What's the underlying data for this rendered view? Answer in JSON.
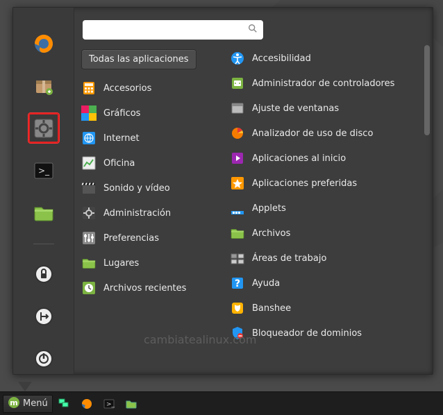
{
  "search": {
    "value": ""
  },
  "all_apps_label": "Todas las aplicaciones",
  "categories": [
    {
      "id": "accesorios",
      "label": "Accesorios",
      "icon": "calculator"
    },
    {
      "id": "graficos",
      "label": "Gráficos",
      "icon": "palette"
    },
    {
      "id": "internet",
      "label": "Internet",
      "icon": "globe"
    },
    {
      "id": "oficina",
      "label": "Oficina",
      "icon": "chart"
    },
    {
      "id": "sonido",
      "label": "Sonido y vídeo",
      "icon": "clapper"
    },
    {
      "id": "administracion",
      "label": "Administración",
      "icon": "gear-dark"
    },
    {
      "id": "preferencias",
      "label": "Preferencias",
      "icon": "sliders"
    },
    {
      "id": "lugares",
      "label": "Lugares",
      "icon": "folder"
    },
    {
      "id": "recientes",
      "label": "Archivos recientes",
      "icon": "clock-green"
    }
  ],
  "apps": [
    {
      "id": "accesibilidad",
      "label": "Accesibilidad",
      "icon": "accessibility"
    },
    {
      "id": "admin-controladores",
      "label": "Administrador de controladores",
      "icon": "driver"
    },
    {
      "id": "ajuste-ventanas",
      "label": "Ajuste de ventanas",
      "icon": "window"
    },
    {
      "id": "analizador-disco",
      "label": "Analizador de uso de disco",
      "icon": "disk-usage"
    },
    {
      "id": "apps-inicio",
      "label": "Aplicaciones al inicio",
      "icon": "startup"
    },
    {
      "id": "apps-preferidas",
      "label": "Aplicaciones preferidas",
      "icon": "star"
    },
    {
      "id": "applets",
      "label": "Applets",
      "icon": "applets"
    },
    {
      "id": "archivos",
      "label": "Archivos",
      "icon": "folder"
    },
    {
      "id": "areas-trabajo",
      "label": "Áreas de trabajo",
      "icon": "workspaces"
    },
    {
      "id": "ayuda",
      "label": "Ayuda",
      "icon": "help"
    },
    {
      "id": "banshee",
      "label": "Banshee",
      "icon": "banshee"
    },
    {
      "id": "bloqueador-dominios",
      "label": "Bloqueador de dominios",
      "icon": "shield"
    }
  ],
  "favorites": [
    {
      "id": "firefox",
      "icon": "firefox",
      "selected": false
    },
    {
      "id": "software",
      "icon": "package",
      "selected": false
    },
    {
      "id": "settings",
      "icon": "gear",
      "selected": true
    },
    {
      "id": "terminal",
      "icon": "terminal",
      "selected": false
    },
    {
      "id": "files",
      "icon": "folder",
      "selected": false
    }
  ],
  "favorites_session": [
    {
      "id": "lock",
      "icon": "lock"
    },
    {
      "id": "logout",
      "icon": "logout"
    },
    {
      "id": "shutdown",
      "icon": "power"
    }
  ],
  "watermark": "cambiatealinux.com",
  "taskbar": {
    "menu_label": "Menú"
  }
}
